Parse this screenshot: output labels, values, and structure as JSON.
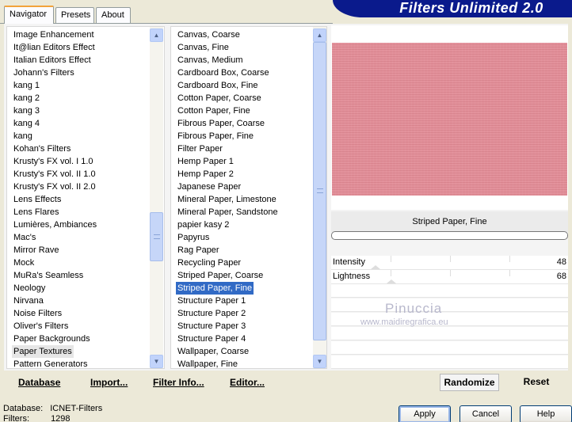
{
  "tabs": [
    {
      "label": "Navigator",
      "active": true
    },
    {
      "label": "Presets",
      "active": false
    },
    {
      "label": "About",
      "active": false
    }
  ],
  "app_title": "Filters Unlimited 2.0",
  "categories": {
    "items": [
      "Image Enhancement",
      "It@lian Editors Effect",
      "Italian Editors Effect",
      "Johann's Filters",
      "kang 1",
      "kang 2",
      "kang 3",
      "kang 4",
      "kang",
      "Kohan's Filters",
      "Krusty's FX vol. I 1.0",
      "Krusty's FX vol. II 1.0",
      "Krusty's FX vol. II 2.0",
      "Lens Effects",
      "Lens Flares",
      "Lumières, Ambiances",
      "Mac's",
      "Mirror Rave",
      "Mock",
      "MuRa's Seamless",
      "Neology",
      "Nirvana",
      "Noise Filters",
      "Oliver's Filters",
      "Paper Backgrounds",
      "Paper Textures",
      "Pattern Generators"
    ],
    "selected": "Paper Textures"
  },
  "filters": {
    "items": [
      "Canvas, Coarse",
      "Canvas, Fine",
      "Canvas, Medium",
      "Cardboard Box, Coarse",
      "Cardboard Box, Fine",
      "Cotton Paper, Coarse",
      "Cotton Paper, Fine",
      "Fibrous Paper, Coarse",
      "Fibrous Paper, Fine",
      "Filter Paper",
      "Hemp Paper 1",
      "Hemp Paper 2",
      "Japanese Paper",
      "Mineral Paper, Limestone",
      "Mineral Paper, Sandstone",
      "papier kasy 2",
      "Papyrus",
      "Rag Paper",
      "Recycling Paper",
      "Striped Paper, Coarse",
      "Striped Paper, Fine",
      "Structure Paper 1",
      "Structure Paper 2",
      "Structure Paper 3",
      "Structure Paper 4",
      "Wallpaper, Coarse",
      "Wallpaper, Fine"
    ],
    "selected": "Striped Paper, Fine"
  },
  "preview": {
    "filter_name": "Striped Paper, Fine",
    "color": "#e2909a"
  },
  "params": [
    {
      "label": "Intensity",
      "value": "48"
    },
    {
      "label": "Lightness",
      "value": "68"
    }
  ],
  "watermark": {
    "name": "Pinuccia",
    "url": "www.maidiregrafica.eu"
  },
  "actions": {
    "database": "Database",
    "import": "Import...",
    "filter_info": "Filter Info...",
    "editor": "Editor...",
    "randomize": "Randomize",
    "reset": "Reset"
  },
  "footer": {
    "database_label": "Database:",
    "database_value": "ICNET-Filters",
    "filters_label": "Filters:",
    "filters_value": "1298"
  },
  "dialog_buttons": {
    "apply": "Apply",
    "cancel": "Cancel",
    "help": "Help"
  }
}
